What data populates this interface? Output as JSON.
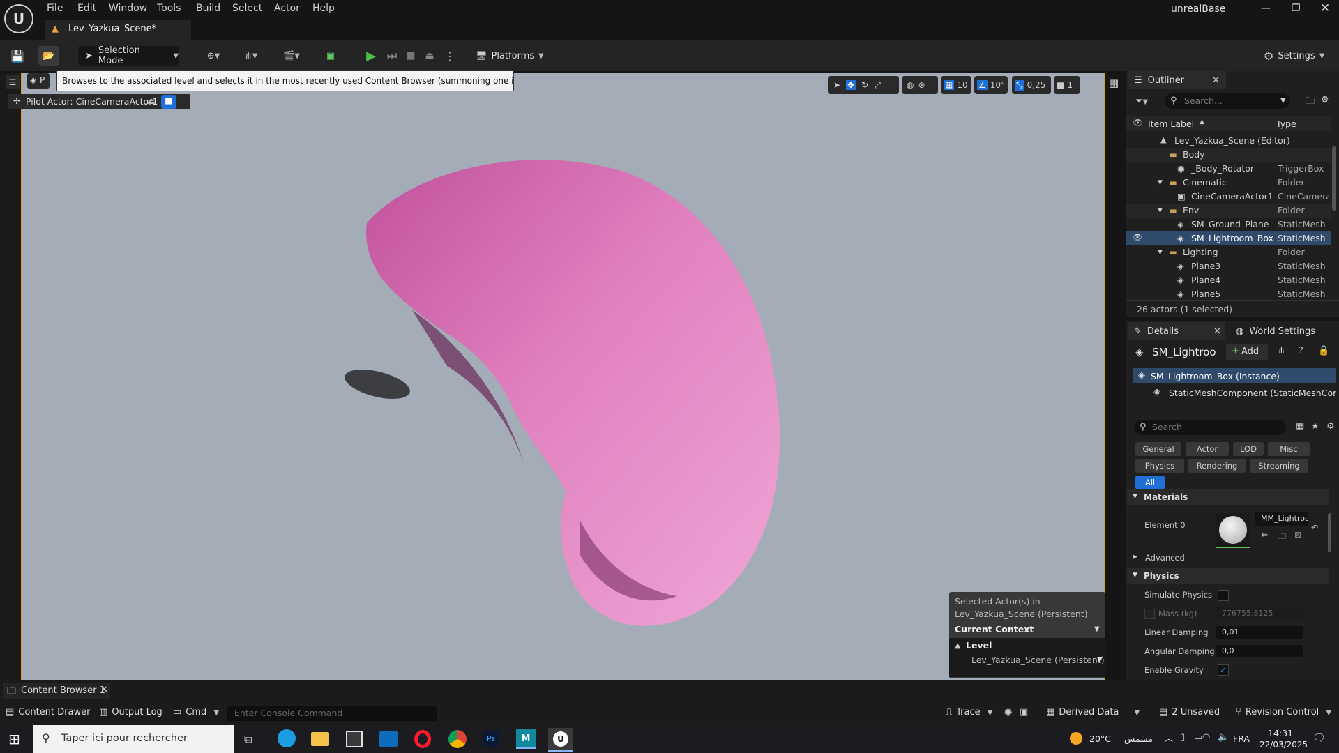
{
  "app": {
    "title": "unrealBase"
  },
  "menu": [
    "File",
    "Edit",
    "Window",
    "Tools",
    "Build",
    "Select",
    "Actor",
    "Help"
  ],
  "level_tab": "Lev_Yazkua_Scene*",
  "toolbar": {
    "selection_mode": "Selection Mode",
    "platforms": "Platforms",
    "settings": "Settings"
  },
  "viewport": {
    "tooltip": "Browses to the associated level and selects it in the most recently used Content Browser (summoning one if necessary)",
    "tab_short": "P",
    "pilot": "Pilot Actor: CineCameraActor1",
    "grid": "10",
    "angle": "10°",
    "scale": "0,25",
    "cam": "1",
    "context": {
      "line1": "Selected Actor(s) in",
      "line2": "Lev_Yazkua_Scene (Persistent)",
      "current": "Current Context",
      "level": "Level",
      "level_name": "Lev_Yazkua_Scene (Persistent)"
    }
  },
  "outliner": {
    "title": "Outliner",
    "search_placeholder": "Search...",
    "col_label": "Item Label",
    "col_type": "Type",
    "rows": [
      {
        "label": "Lev_Yazkua_Scene (Editor)",
        "type": ""
      },
      {
        "label": "Body",
        "type": ""
      },
      {
        "label": "_Body_Rotator",
        "type": "TriggerBox"
      },
      {
        "label": "Cinematic",
        "type": "Folder"
      },
      {
        "label": "CineCameraActor1",
        "type": "CineCamera"
      },
      {
        "label": "Env",
        "type": "Folder"
      },
      {
        "label": "SM_Ground_Plane",
        "type": "StaticMesh"
      },
      {
        "label": "SM_Lightroom_Box",
        "type": "StaticMesh"
      },
      {
        "label": "Lighting",
        "type": "Folder"
      },
      {
        "label": "Plane3",
        "type": "StaticMesh"
      },
      {
        "label": "Plane4",
        "type": "StaticMesh"
      },
      {
        "label": "Plane5",
        "type": "StaticMesh"
      }
    ],
    "footer": "26 actors (1 selected)"
  },
  "details": {
    "tab_details": "Details",
    "tab_world": "World Settings",
    "object_name": "SM_Lightroo",
    "add": "Add",
    "instance": "SM_Lightroom_Box (Instance)",
    "component": "StaticMeshComponent (StaticMeshComp",
    "search_placeholder": "Search",
    "filters": [
      "General",
      "Actor",
      "LOD",
      "Misc",
      "Physics",
      "Rendering",
      "Streaming",
      "All"
    ],
    "materials_header": "Materials",
    "element0": "Element 0",
    "material_name": "MM_Lightroo",
    "advanced": "Advanced",
    "physics_header": "Physics",
    "simulate": "Simulate Physics",
    "mass": "Mass (kg)",
    "mass_value": "776755,8125",
    "linear": "Linear Damping",
    "linear_value": "0,01",
    "angular": "Angular Damping",
    "angular_value": "0,0",
    "gravity": "Enable Gravity"
  },
  "bottom": {
    "content_browser_tab": "Content Browser 1",
    "content_drawer": "Content Drawer",
    "output_log": "Output Log",
    "cmd": "Cmd",
    "console_placeholder": "Enter Console Command",
    "trace": "Trace",
    "derived": "Derived Data",
    "unsaved": "2 Unsaved",
    "revision": "Revision Control"
  },
  "taskbar": {
    "search_placeholder": "Taper ici pour rechercher",
    "weather": "20°C",
    "weather_text": "مشمس",
    "lang": "FRA",
    "time": "14:31",
    "date": "22/03/2025"
  }
}
